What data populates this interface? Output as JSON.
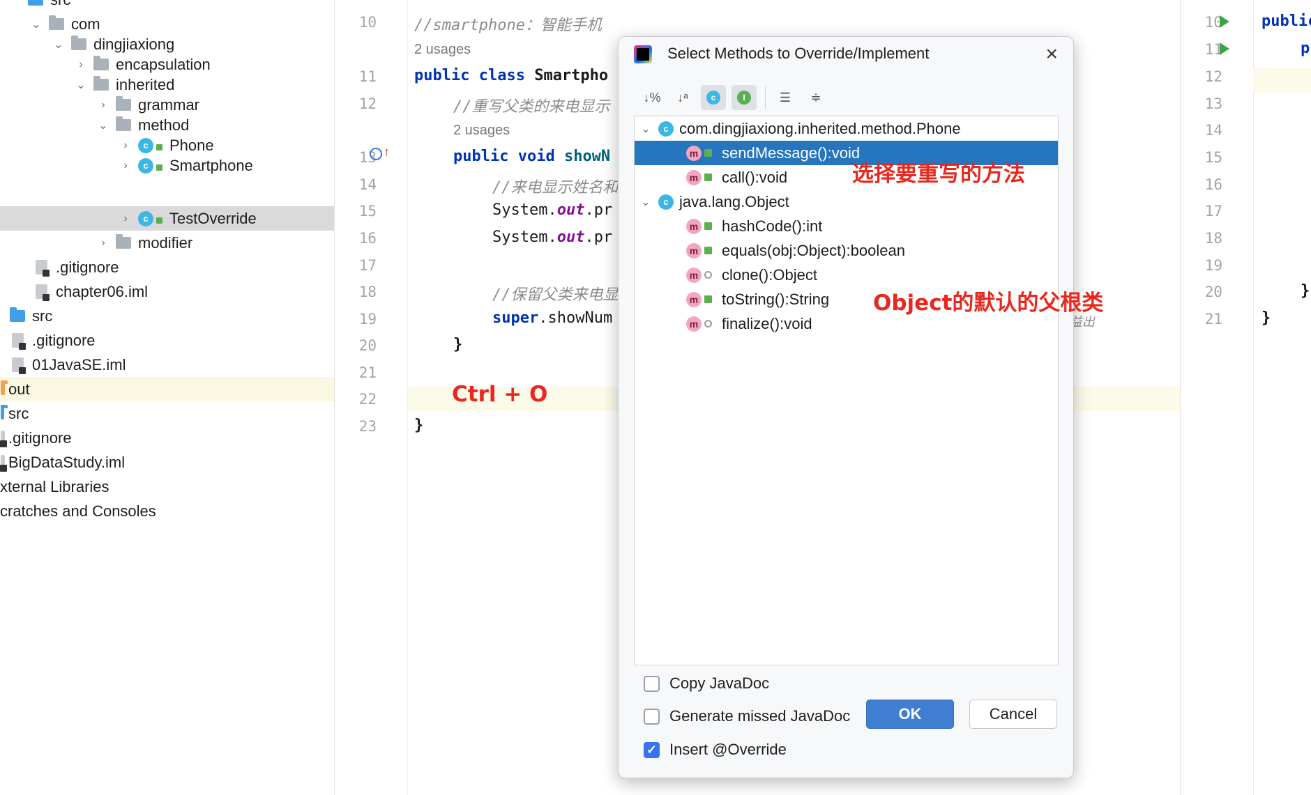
{
  "tree": {
    "items": [
      {
        "label": "src",
        "icon": "folder-blue-icon"
      },
      {
        "label": "com",
        "icon": "folder-icon"
      },
      {
        "label": "dingjiaxiong",
        "icon": "folder-icon"
      },
      {
        "label": "encapsulation",
        "icon": "folder-icon"
      },
      {
        "label": "inherited",
        "icon": "folder-icon"
      },
      {
        "label": "grammar",
        "icon": "folder-icon"
      },
      {
        "label": "method",
        "icon": "folder-icon"
      },
      {
        "label": "Phone",
        "icon": "class-icon"
      },
      {
        "label": "Smartphone",
        "icon": "class-icon"
      },
      {
        "label": "TestOverride",
        "icon": "class-runnable-icon"
      },
      {
        "label": "modifier",
        "icon": "folder-icon"
      },
      {
        "label": ".gitignore",
        "icon": "file-icon"
      },
      {
        "label": "chapter06.iml",
        "icon": "file-icon"
      },
      {
        "label": "src",
        "icon": "folder-blue-icon"
      },
      {
        "label": ".gitignore",
        "icon": "file-icon"
      },
      {
        "label": "01JavaSE.iml",
        "icon": "file-icon"
      },
      {
        "label": "out",
        "icon": "folder-orange-icon"
      },
      {
        "label": "src",
        "icon": "folder-blue-icon"
      },
      {
        "label": ".gitignore",
        "icon": "file-icon"
      },
      {
        "label": "BigDataStudy.iml",
        "icon": "file-icon"
      },
      {
        "label": "xternal Libraries",
        "icon": "none"
      },
      {
        "label": "cratches and Consoles",
        "icon": "none"
      }
    ]
  },
  "editor": {
    "line_numbers": [
      "10",
      "11",
      "12",
      "13",
      "14",
      "15",
      "16",
      "17",
      "18",
      "19",
      "20",
      "21",
      "22",
      "23"
    ],
    "usages": [
      "2 usages",
      "2 usages"
    ],
    "lines": {
      "l10_comment": "//smartphone：智能手机",
      "l11_kw": "public class",
      "l11_rest": " Smartpho",
      "l12": "//重写父类的来电显示",
      "l13_kw": "public void",
      "l13_rest": " showN",
      "l14": "//来电显示姓名和",
      "l15_a": "System.",
      "l15_b": "out",
      "l15_c": ".pr",
      "l16_a": "System.",
      "l16_b": "out",
      "l16_c": ".pr",
      "l18": "//保留父类来电显",
      "l19_kw": "super",
      "l19_rest": ".showNum",
      "l20": "}",
      "l23": "}"
    },
    "stray_text": "益出"
  },
  "right_pane": {
    "line_numbers": [
      "10",
      "11",
      "12",
      "13",
      "14",
      "15",
      "16",
      "17",
      "18",
      "19",
      "20",
      "21"
    ],
    "code": {
      "l10": "public",
      "l11": "pu",
      "l20": "}",
      "l21": "}"
    }
  },
  "annotations": {
    "shortcut": "Ctrl + O",
    "select_method": "选择要重写的方法",
    "object_root": "Object的默认的父根类"
  },
  "dialog": {
    "title": "Select Methods to Override/Implement",
    "close_icon": "×",
    "toolbar": [
      "sort-visibility-icon",
      "sort-alpha-icon",
      "show-classes-icon",
      "show-interfaces-icon",
      "expand-all-icon",
      "collapse-all-icon"
    ],
    "groups": [
      {
        "name": "com.dingjiaxiong.inherited.method.Phone",
        "methods": [
          {
            "label": "sendMessage():void",
            "selected": true,
            "access": "public"
          },
          {
            "label": "call():void",
            "selected": false,
            "access": "public"
          }
        ]
      },
      {
        "name": "java.lang.Object",
        "methods": [
          {
            "label": "hashCode():int",
            "selected": false,
            "access": "public"
          },
          {
            "label": "equals(obj:Object):boolean",
            "selected": false,
            "access": "public"
          },
          {
            "label": "clone():Object",
            "selected": false,
            "access": "protected"
          },
          {
            "label": "toString():String",
            "selected": false,
            "access": "public"
          },
          {
            "label": "finalize():void",
            "selected": false,
            "access": "protected"
          }
        ]
      }
    ],
    "options": [
      {
        "label": "Copy JavaDoc",
        "checked": false
      },
      {
        "label": "Generate missed JavaDoc",
        "checked": false
      },
      {
        "label": "Insert @Override",
        "checked": true
      }
    ],
    "ok_label": "OK",
    "cancel_label": "Cancel"
  },
  "colors": {
    "selection": "#2675bf",
    "accent": "#3f7ed1",
    "annotation": "#e8281e",
    "keyword": "#0033b3"
  }
}
